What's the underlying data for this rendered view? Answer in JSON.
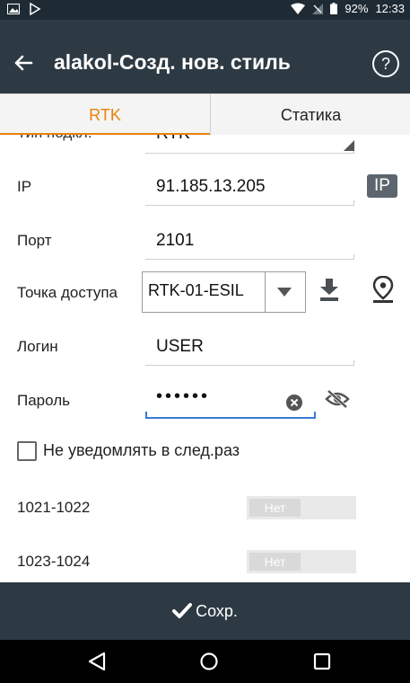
{
  "status_bar": {
    "battery": "92%",
    "time": "12:33"
  },
  "app_bar": {
    "title": "alakol-Созд. нов. стиль"
  },
  "tabs": [
    {
      "label": "RTK"
    },
    {
      "label": "Статика"
    }
  ],
  "form": {
    "partial_row": {
      "label": "Тип подкл.",
      "value": "RTK"
    },
    "ip": {
      "label": "IP",
      "value": "91.185.13.205",
      "badge": "IP"
    },
    "port": {
      "label": "Порт",
      "value": "2101"
    },
    "mountpoint": {
      "label": "Точка доступа",
      "value": "RTK-01-ESIL"
    },
    "login": {
      "label": "Логин",
      "value": "USER"
    },
    "password": {
      "label": "Пароль",
      "value": "••••••"
    },
    "dont_notify": {
      "label": "Не уведомлять в след.раз",
      "checked": false
    },
    "msg_1021": {
      "label": "1021-1022",
      "toggle": "Нет"
    },
    "msg_1023": {
      "label": "1023-1024",
      "toggle": "Нет"
    }
  },
  "save": {
    "label": "Сохр."
  },
  "colors": {
    "accent": "#e8820c",
    "appbar": "#2d3a43",
    "focus": "#3a7bd5"
  }
}
